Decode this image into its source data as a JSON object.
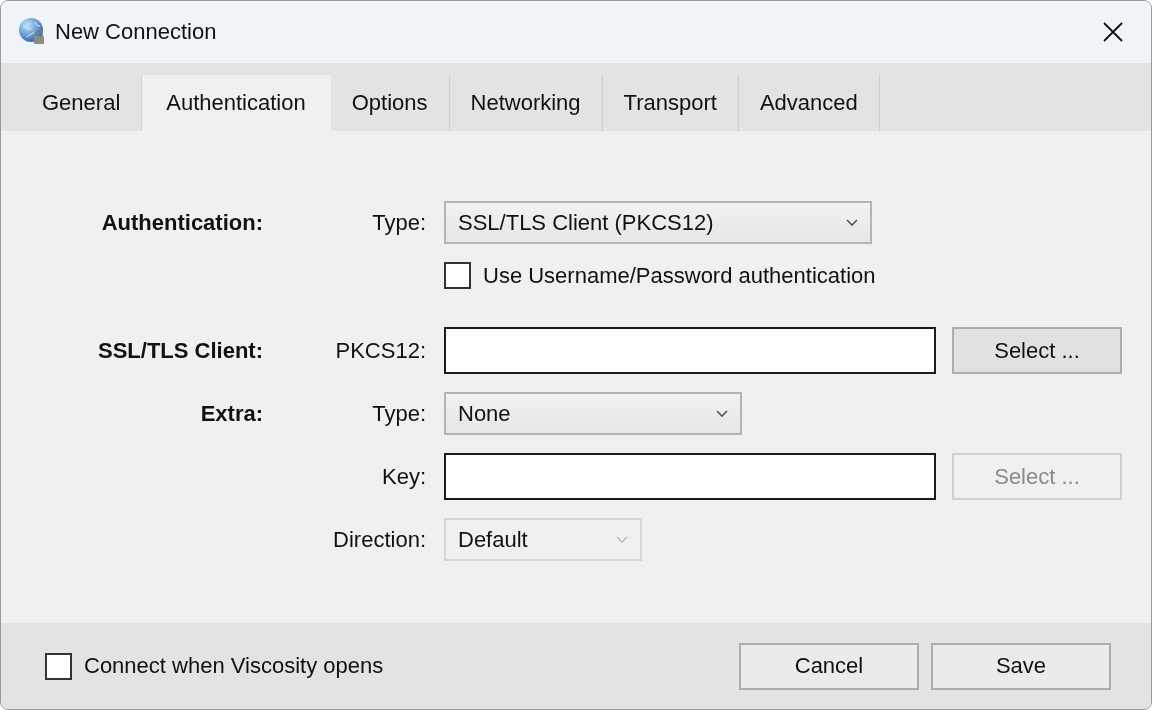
{
  "window": {
    "title": "New Connection"
  },
  "tabs": [
    {
      "label": "General",
      "selected": false
    },
    {
      "label": "Authentication",
      "selected": true
    },
    {
      "label": "Options",
      "selected": false
    },
    {
      "label": "Networking",
      "selected": false
    },
    {
      "label": "Transport",
      "selected": false
    },
    {
      "label": "Advanced",
      "selected": false
    }
  ],
  "form": [
    {
      "section": "Authentication:",
      "label": "Type:",
      "kind": "dropdown",
      "value": "SSL/TLS Client (PKCS12)",
      "disabled": false
    },
    {
      "kind": "checkbox",
      "label": "Use Username/Password authentication",
      "checked": false
    },
    {
      "section": "SSL/TLS Client:",
      "label": "PKCS12:",
      "kind": "file",
      "button": {
        "label": "Select ...",
        "disabled": false
      }
    },
    {
      "section": "Extra:",
      "label": "Type:",
      "kind": "dropdown",
      "value": "None",
      "disabled": false
    },
    {
      "label": "Key:",
      "kind": "file",
      "button": {
        "label": "Select ...",
        "disabled": true
      }
    },
    {
      "label": "Direction:",
      "kind": "dropdown",
      "value": "Default",
      "disabled": true
    }
  ],
  "footer": {
    "checkbox": {
      "label": "Connect when Viscosity opens",
      "checked": false
    },
    "buttons": [
      "Cancel",
      "Save"
    ]
  }
}
